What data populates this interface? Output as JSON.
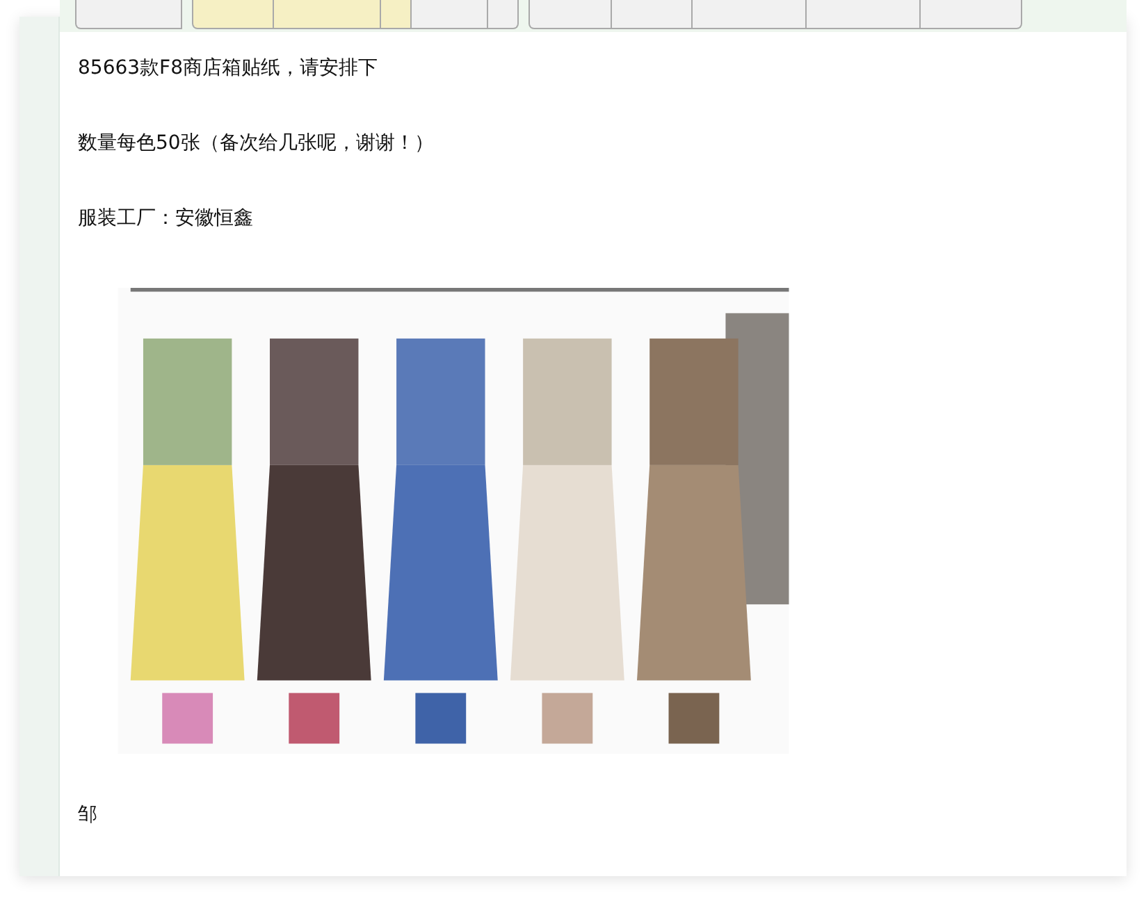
{
  "toolbar": {
    "groups": [
      {
        "buttons": [
          {
            "highlighted": false
          }
        ]
      },
      {
        "buttons": [
          {
            "highlighted": true
          },
          {
            "highlighted": true
          },
          {
            "highlighted": true
          },
          {
            "highlighted": false
          },
          {
            "highlighted": false
          }
        ]
      },
      {
        "buttons": [
          {
            "highlighted": false
          },
          {
            "highlighted": false
          },
          {
            "highlighted": false
          },
          {
            "highlighted": false
          },
          {
            "highlighted": false
          }
        ]
      }
    ]
  },
  "message": {
    "paragraphs": [
      "85663款F8商店箱贴纸，请安排下",
      "数量每色50张（备次给几张呢，谢谢！）",
      "服装工厂：安徽恒鑫"
    ],
    "signature": "邹"
  }
}
